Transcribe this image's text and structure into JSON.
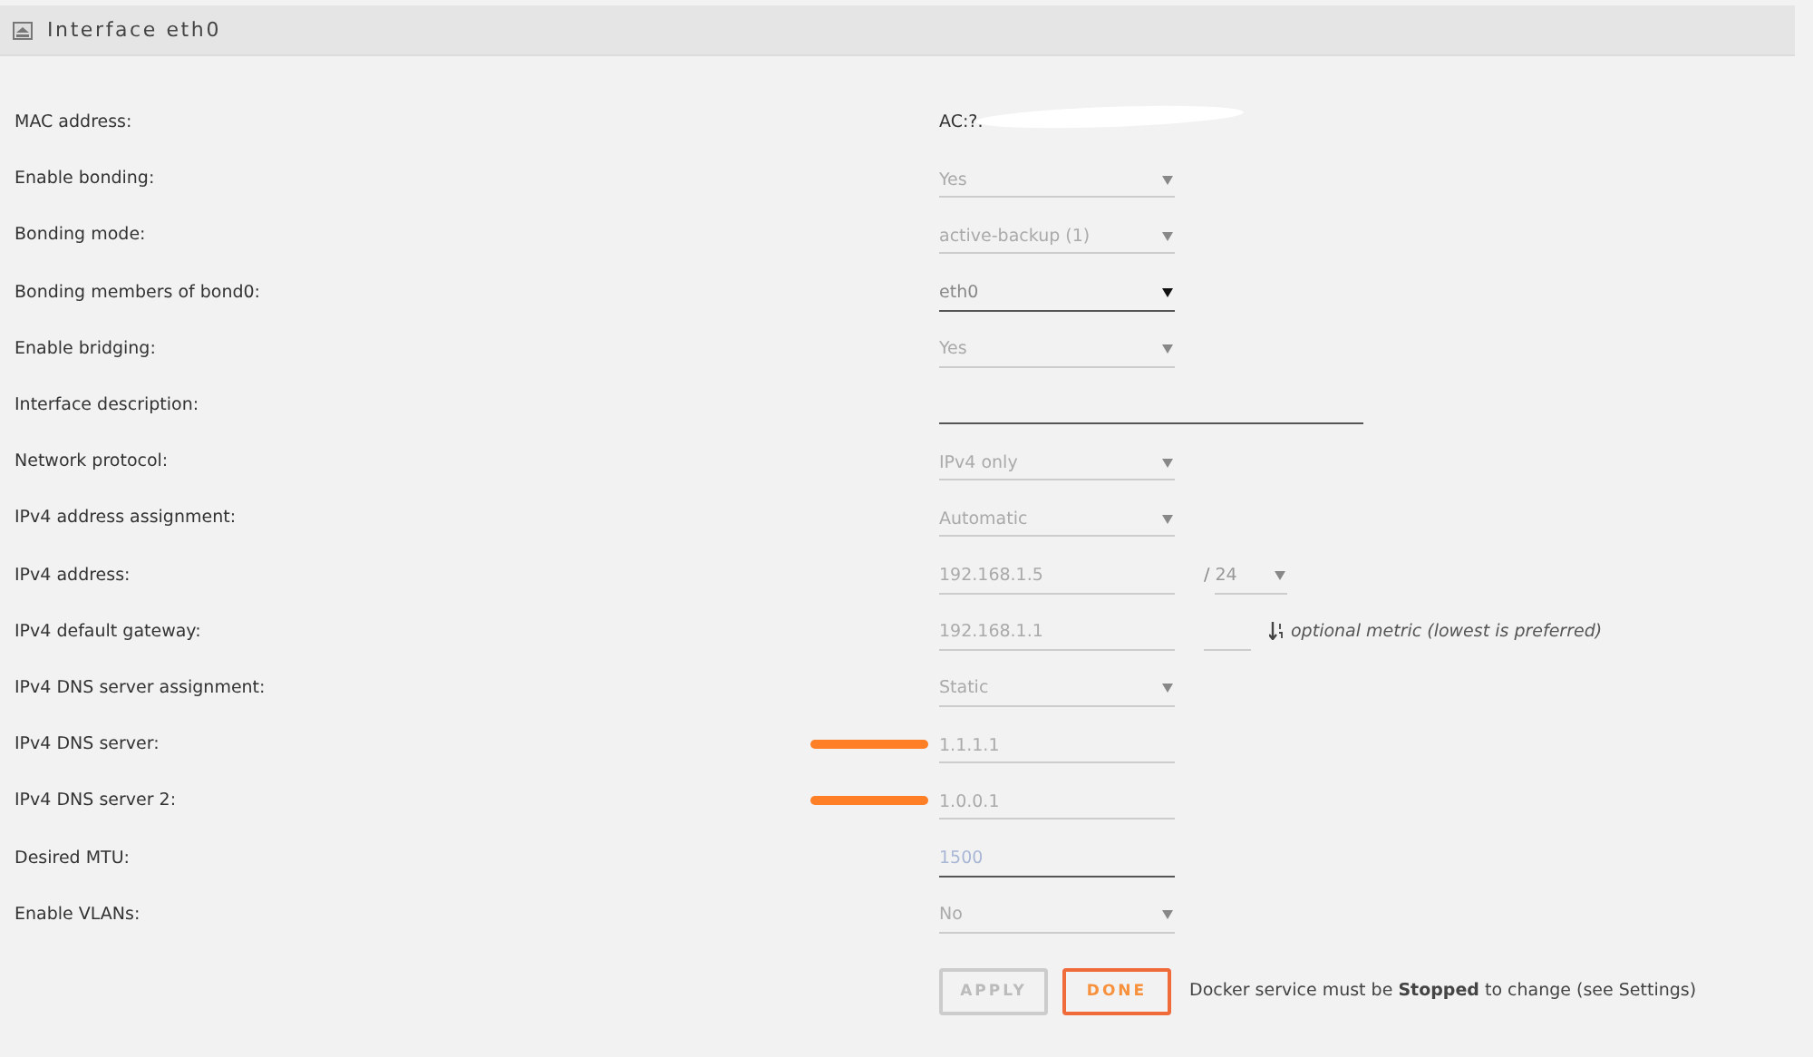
{
  "panel": {
    "title": "Interface eth0"
  },
  "rows": [
    {
      "label": "MAC address:",
      "kind": "text",
      "value": "AC:?.",
      "redacted": true,
      "annotated": false
    },
    {
      "label": "Enable bonding:",
      "kind": "select",
      "value": "Yes",
      "disabled": true,
      "annotated": false
    },
    {
      "label": "Bonding mode:",
      "kind": "select",
      "value": "active-backup (1)",
      "disabled": true,
      "annotated": false
    },
    {
      "label": "Bonding members of bond0:",
      "kind": "select",
      "value": "eth0",
      "disabled": false,
      "annotated": false
    },
    {
      "label": "Enable bridging:",
      "kind": "select",
      "value": "Yes",
      "disabled": true,
      "annotated": false
    },
    {
      "label": "Interface description:",
      "kind": "input",
      "disabled": false,
      "wide": true,
      "annotated": false
    },
    {
      "label": "Network protocol:",
      "kind": "select",
      "value": "IPv4 only",
      "disabled": true,
      "annotated": false
    },
    {
      "label": "IPv4 address assignment:",
      "kind": "select",
      "value": "Automatic",
      "disabled": true,
      "annotated": false
    },
    {
      "label": "IPv4 address:",
      "kind": "input",
      "value": "192.168.1.5",
      "disabled": true,
      "annotated": false,
      "extra": {
        "kind": "mask",
        "separator": "/",
        "value": "24"
      }
    },
    {
      "label": "IPv4 default gateway:",
      "kind": "input",
      "value": "192.168.1.1",
      "disabled": true,
      "annotated": false,
      "extra": {
        "kind": "metric",
        "hint": "optional metric (lowest is preferred)"
      }
    },
    {
      "label": "IPv4 DNS server assignment:",
      "kind": "select",
      "value": "Static",
      "disabled": true,
      "annotated": false
    },
    {
      "label": "IPv4 DNS server:",
      "kind": "input",
      "value": "1.1.1.1",
      "disabled": true,
      "annotated": true
    },
    {
      "label": "IPv4 DNS server 2:",
      "kind": "input",
      "value": "1.0.0.1",
      "disabled": true,
      "annotated": true
    },
    {
      "label": "Desired MTU:",
      "kind": "input",
      "placeholder": "1500",
      "disabled": false,
      "annotated": false
    },
    {
      "label": "Enable VLANs:",
      "kind": "select",
      "value": "No",
      "disabled": true,
      "annotated": false
    }
  ],
  "buttons": [
    {
      "label": "APPLY",
      "disabled": true
    },
    {
      "label": "DONE",
      "disabled": false
    }
  ],
  "note": "Docker service must be **Stopped** to change (see Settings)"
}
